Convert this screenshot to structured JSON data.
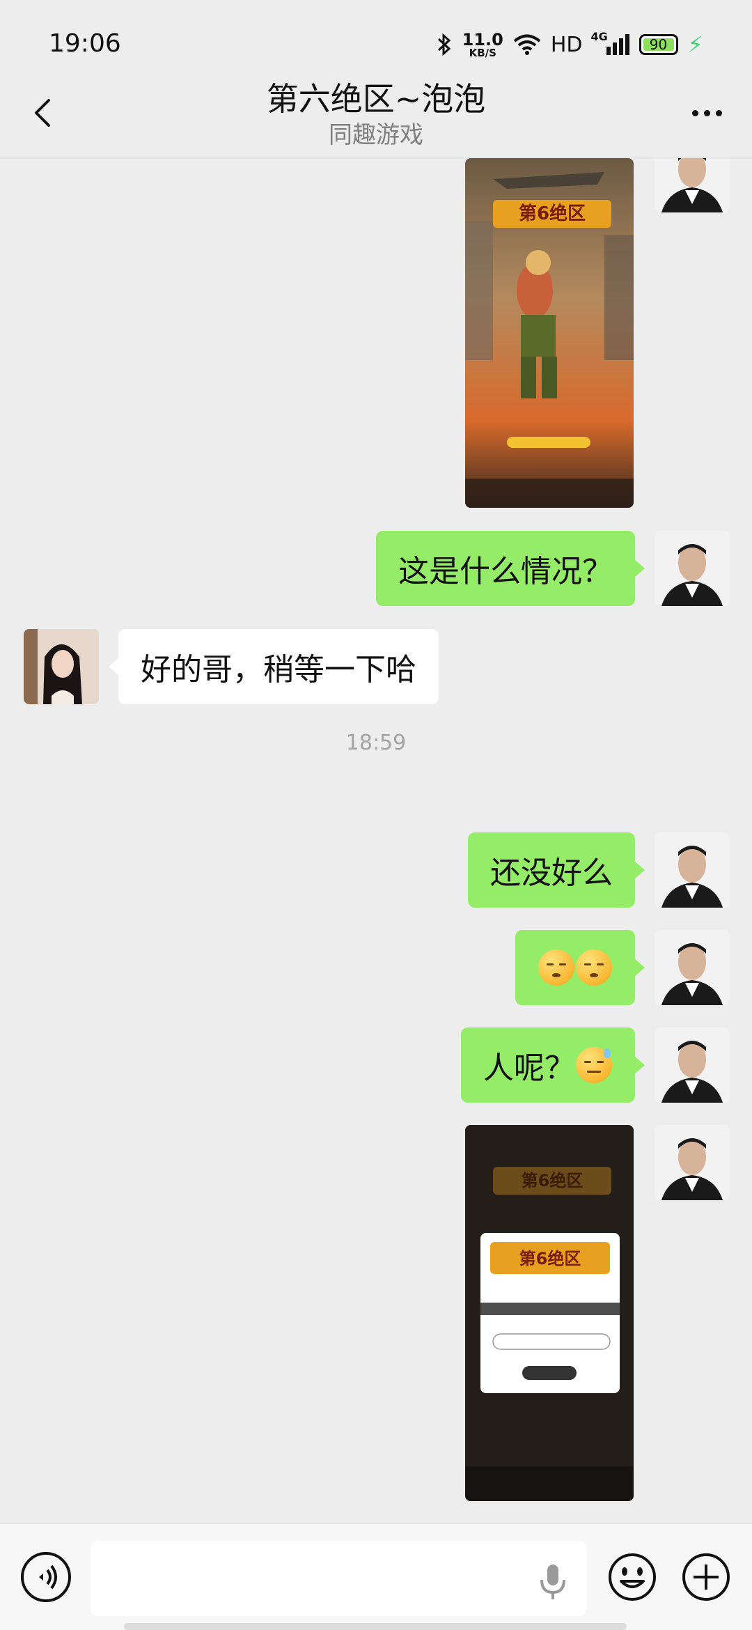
{
  "status_bar": {
    "time": "19:06",
    "net_speed_value": "11.0",
    "net_speed_unit": "KB/S",
    "hd_label": "HD",
    "network_label": "4G",
    "battery_level": "90",
    "icons": [
      "bluetooth-icon",
      "wifi-icon",
      "signal-icon",
      "battery-icon",
      "charging-bolt-icon"
    ]
  },
  "header": {
    "title": "第六绝区~泡泡",
    "subtitle": "同趣游戏",
    "back_icon": "chevron-left-icon",
    "more_icon": "more-dots-icon"
  },
  "messages": [
    {
      "side": "me",
      "type": "image",
      "description_icon": "game-screenshot"
    },
    {
      "side": "me",
      "type": "text",
      "text": "这是什么情况？"
    },
    {
      "side": "her",
      "type": "text",
      "text": "好的哥，稍等一下哈"
    },
    {
      "type": "time",
      "text": "18:59"
    },
    {
      "side": "me",
      "type": "text",
      "text": "还没好么"
    },
    {
      "side": "me",
      "type": "emoji",
      "emojis": [
        "shush-face-emoji",
        "shush-face-emoji"
      ]
    },
    {
      "side": "me",
      "type": "text",
      "text": "人呢？",
      "emoji": "sweat-face-emoji"
    },
    {
      "side": "me",
      "type": "image",
      "description_icon": "game-login-screenshot"
    }
  ],
  "input_bar": {
    "text_value": "",
    "icons": [
      "voice-icon",
      "mic-icon",
      "emoji-icon",
      "plus-icon"
    ]
  },
  "colors": {
    "background": "#ededed",
    "my_bubble": "#95ec69",
    "their_bubble": "#ffffff",
    "timestamp": "#a3a3a3"
  }
}
